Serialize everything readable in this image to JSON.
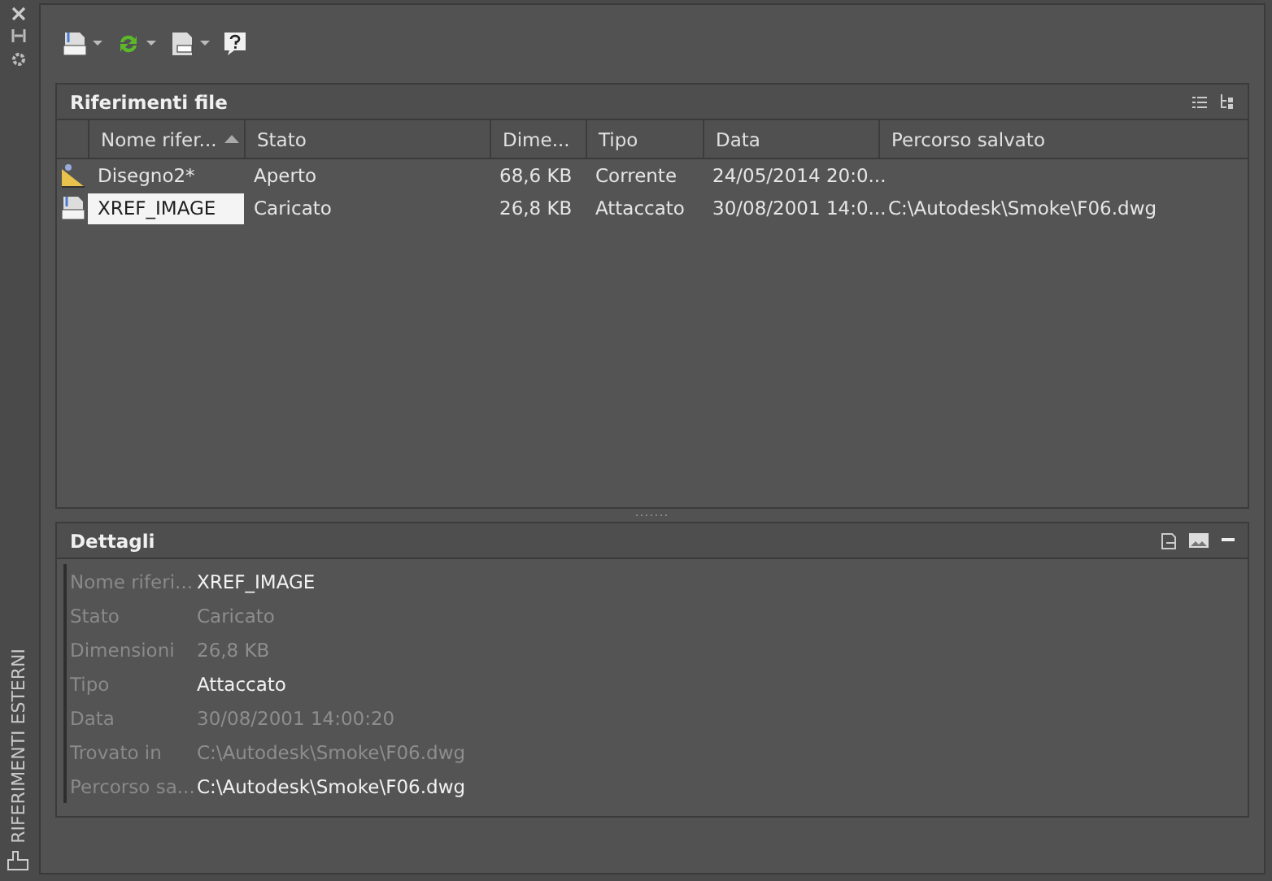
{
  "side_strip": {
    "title": "RIFERIMENTI ESTERNI"
  },
  "file_refs": {
    "title": "Riferimenti file",
    "columns": [
      {
        "label": "Nome rifer...",
        "sorted": true
      },
      {
        "label": "Stato",
        "sorted": false
      },
      {
        "label": "Dime...",
        "sorted": false
      },
      {
        "label": "Tipo",
        "sorted": false
      },
      {
        "label": "Data",
        "sorted": false
      },
      {
        "label": "Percorso salvato",
        "sorted": false
      }
    ],
    "rows": [
      {
        "kind": "drawing",
        "selected": false,
        "cells": [
          "Disegno2*",
          "Aperto",
          "68,6 KB",
          "Corrente",
          "24/05/2014 20:0..."
        ]
      },
      {
        "kind": "dwg",
        "selected": true,
        "cells": [
          "XREF_IMAGE",
          "Caricato",
          "26,8 KB",
          "Attaccato",
          "30/08/2001 14:0...",
          "C:\\Autodesk\\Smoke\\F06.dwg"
        ]
      }
    ]
  },
  "details": {
    "title": "Dettagli",
    "rows": [
      {
        "label": "Nome riferi...",
        "value": "XREF_IMAGE",
        "dimmed": false
      },
      {
        "label": "Stato",
        "value": "Caricato",
        "dimmed": true
      },
      {
        "label": "Dimensioni",
        "value": "26,8 KB",
        "dimmed": true
      },
      {
        "label": "Tipo",
        "value": "Attaccato",
        "dimmed": false
      },
      {
        "label": "Data",
        "value": "30/08/2001 14:00:20",
        "dimmed": true
      },
      {
        "label": "Trovato in",
        "value": "C:\\Autodesk\\Smoke\\F06.dwg",
        "dimmed": true
      },
      {
        "label": "Percorso sa...",
        "value": "C:\\Autodesk\\Smoke\\F06.dwg",
        "dimmed": false
      }
    ]
  }
}
